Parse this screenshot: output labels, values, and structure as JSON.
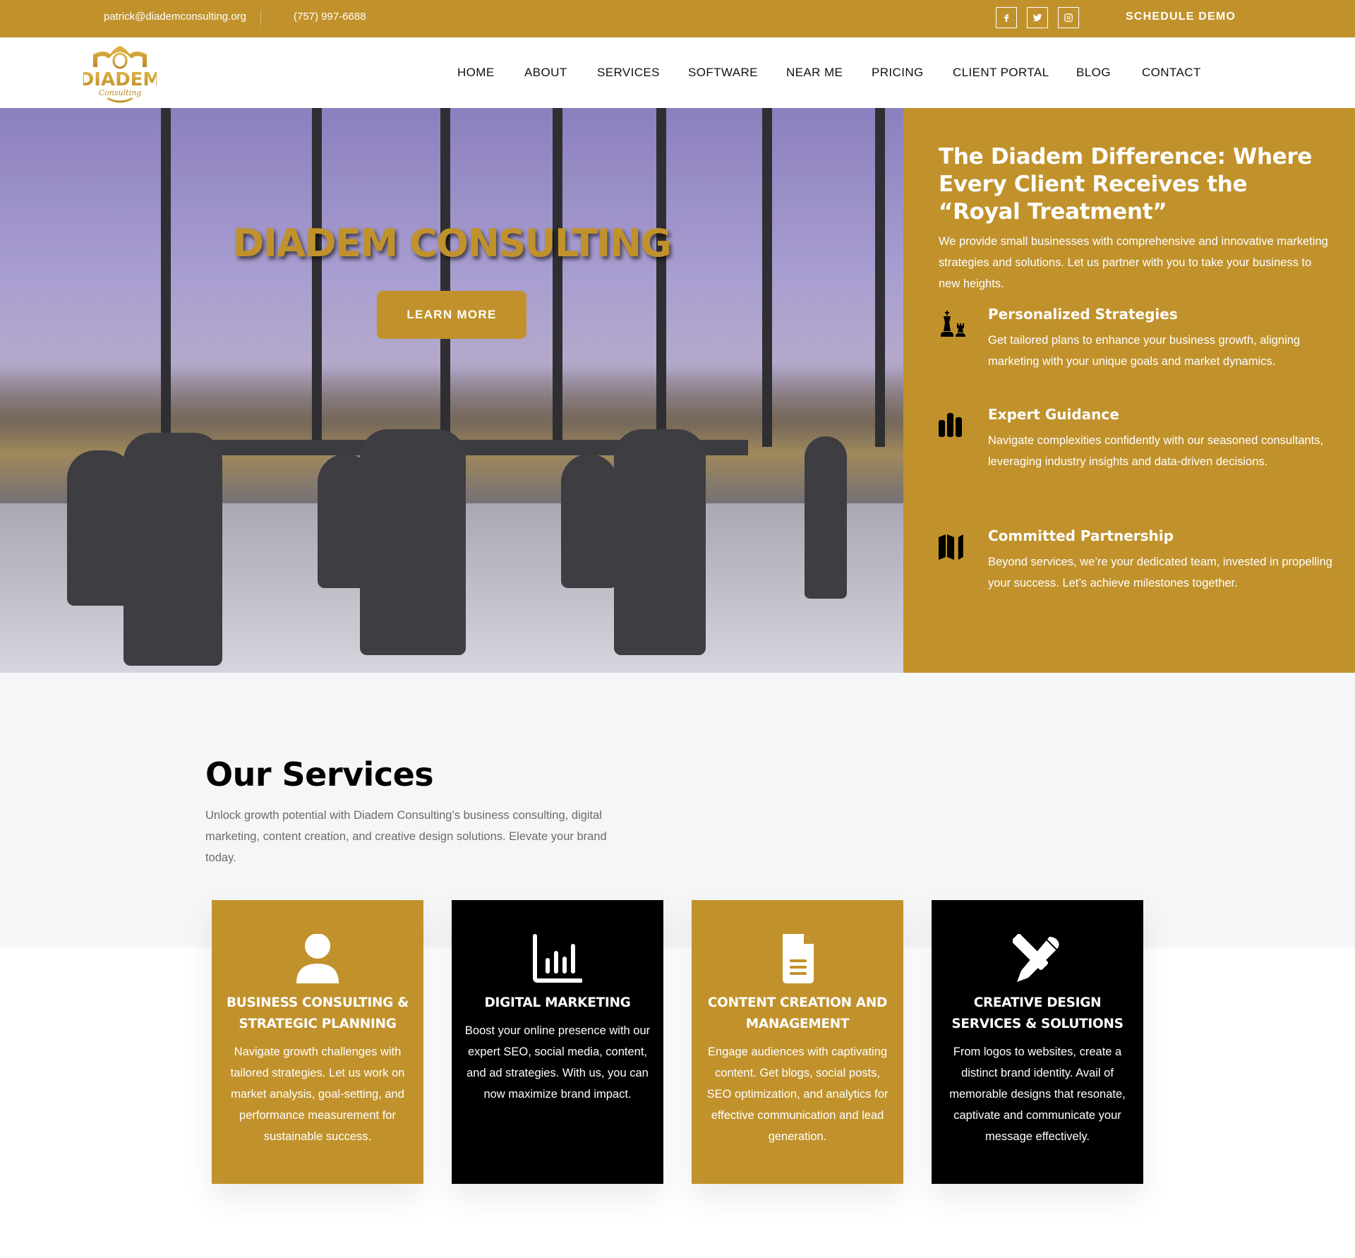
{
  "topbar": {
    "email": "patrick@diademconsulting.org",
    "phone": "(757) 997-6688",
    "social": [
      {
        "name": "facebook",
        "icon": "facebook-icon"
      },
      {
        "name": "twitter",
        "icon": "twitter-icon"
      },
      {
        "name": "instagram",
        "icon": "instagram-icon"
      }
    ],
    "cta_label": "SCHEDULE DEMO"
  },
  "brand": {
    "logo_word": "DIADEM",
    "logo_script": "Consulting",
    "accent_color": "#C1922C"
  },
  "nav": {
    "items": [
      {
        "label": "HOME"
      },
      {
        "label": "ABOUT"
      },
      {
        "label": "SERVICES"
      },
      {
        "label": "SOFTWARE"
      },
      {
        "label": "NEAR ME"
      },
      {
        "label": "PRICING"
      },
      {
        "label": "CLIENT PORTAL"
      },
      {
        "label": "BLOG"
      },
      {
        "label": "CONTACT"
      }
    ]
  },
  "hero": {
    "title": "DIADEM CONSULTING",
    "button_label": "LEARN MORE"
  },
  "difference": {
    "heading": "The Diadem Difference: Where Every Client Receives the “Royal Treatment”",
    "intro": "We provide small businesses with comprehensive and innovative marketing strategies and solutions. Let us partner with you to take your business to new heights.",
    "features": [
      {
        "icon": "chess-icon",
        "title": "Personalized Strategies",
        "text": "Get tailored plans to enhance your business growth, aligning marketing with your unique goals and market dynamics."
      },
      {
        "icon": "bar-chart-icon",
        "title": "Expert Guidance",
        "text": "Navigate complexities confidently with our seasoned consultants, leveraging industry insights and data-driven decisions."
      },
      {
        "icon": "map-icon",
        "title": "Committed Partnership",
        "text": "Beyond services, we’re your dedicated team, invested in propelling your success. Let’s achieve milestones together."
      }
    ]
  },
  "services": {
    "title": "Our Services",
    "subtitle": "Unlock growth potential with Diadem Consulting’s business consulting, digital marketing, content creation, and creative design solutions. Elevate your brand today.",
    "cards": [
      {
        "icon": "user-icon",
        "title": "BUSINESS CONSULTING & STRATEGIC PLANNING",
        "text": "Navigate growth challenges with tailored strategies. Let us work on market analysis, goal-setting, and performance measurement for sustainable success."
      },
      {
        "icon": "chart-line-icon",
        "title": "DIGITAL MARKETING",
        "text": "Boost your online presence with our expert SEO, social media, content, and ad strategies. With us, you can now maximize brand impact."
      },
      {
        "icon": "document-icon",
        "title": "CONTENT CREATION AND MANAGEMENT",
        "text": "Engage audiences with captivating content. Get blogs, social posts, SEO optimization, and analytics for effective communication and lead generation."
      },
      {
        "icon": "pencil-ruler-icon",
        "title": "CREATIVE DESIGN SERVICES & SOLUTIONS",
        "text": "From logos to websites, create a distinct brand identity. Avail of memorable designs that resonate, captivate and communicate your message effectively."
      }
    ]
  }
}
